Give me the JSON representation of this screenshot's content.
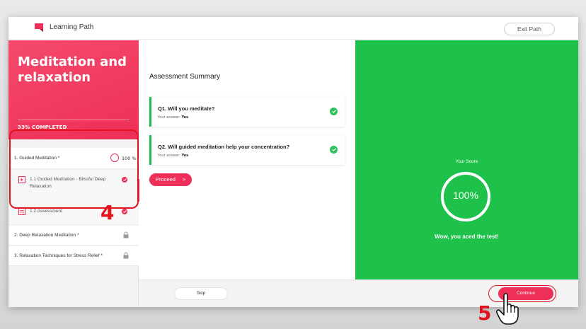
{
  "header": {
    "brand": "Learning Path",
    "exit_label": "Exit Path"
  },
  "sidebar": {
    "course_title": "Meditation and relaxation",
    "progress_label": "33% COMPLETED",
    "modules": [
      {
        "label": "1. Guided Meditation *",
        "percent": "100 %",
        "lessons": [
          {
            "label": "1.1 Guided Meditation - Blissful Deep Relaxation",
            "icon": "video-icon",
            "status": "completed"
          },
          {
            "label": "1.2 Assessment",
            "icon": "quiz-icon",
            "status": "completed"
          }
        ]
      },
      {
        "label": "2. Deep Relaxation Meditation *",
        "locked": true
      },
      {
        "label": "3. Relaxation Techniques for Stress Relief *",
        "locked": true
      }
    ]
  },
  "main": {
    "title": "Assessment Summary",
    "questions": [
      {
        "text": "Q1. Will you meditate?",
        "answer_label": "Your answer:",
        "answer": "Yes"
      },
      {
        "text": "Q2. Will guided meditation help your concentration?",
        "answer_label": "Your answer:",
        "answer": "Yes"
      }
    ],
    "proceed_label": "Proceed",
    "proceed_arrow": ">"
  },
  "score": {
    "label": "Your Score",
    "value": "100%",
    "message": "Wow, you aced the test!"
  },
  "footer": {
    "skip_label": "Skip",
    "continue_label": "Continue"
  },
  "annotations": {
    "step_4": "4",
    "step_5": "5"
  },
  "colors": {
    "accent": "#ee2f57",
    "success": "#1ec24a",
    "annotation": "#e1141d"
  }
}
